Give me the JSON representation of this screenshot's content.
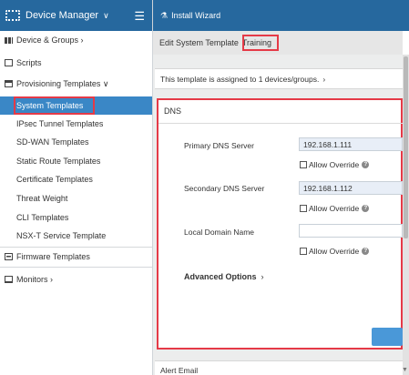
{
  "sidebar": {
    "title": "Device Manager",
    "title_chevron": "∨",
    "menu_icon": "hamburger-icon",
    "items": [
      {
        "label": "Device & Groups",
        "suffix": "›",
        "icon": "device-groups-icon"
      },
      {
        "label": "Scripts",
        "suffix": "",
        "icon": "scripts-icon"
      },
      {
        "label": "Provisioning Templates",
        "suffix": "∨",
        "icon": "provisioning-icon"
      },
      {
        "label": "System Templates"
      },
      {
        "label": "IPsec Tunnel Templates"
      },
      {
        "label": "SD-WAN Templates"
      },
      {
        "label": "Static Route Templates"
      },
      {
        "label": "Certificate Templates"
      },
      {
        "label": "Threat Weight"
      },
      {
        "label": "CLI Templates"
      },
      {
        "label": "NSX-T Service Template"
      },
      {
        "label": "Firmware Templates",
        "suffix": "",
        "icon": "firmware-icon"
      },
      {
        "label": "Monitors",
        "suffix": "›",
        "icon": "monitor-icon"
      }
    ]
  },
  "topbar": {
    "wizard_label": "Install Wizard",
    "wizard_icon": "wand-icon"
  },
  "breadcrumb": {
    "prefix": "Edit System Template",
    "template_name": "Training"
  },
  "assignment": {
    "text": "This template is assigned to 1 devices/groups.",
    "arrow": "›"
  },
  "dns": {
    "heading": "DNS",
    "primary_label": "Primary DNS Server",
    "primary_value": "192.168.1.111",
    "secondary_label": "Secondary DNS Server",
    "secondary_value": "192.168.1.112",
    "domain_label": "Local Domain Name",
    "domain_value": "",
    "allow_override": "Allow Override",
    "advanced_label": "Advanced Options",
    "advanced_arrow": "›"
  },
  "alert_email": {
    "heading": "Alert Email"
  },
  "colors": {
    "header_blue": "#26689e",
    "active_blue": "#3a87c6",
    "highlight_red": "#e53a47"
  }
}
